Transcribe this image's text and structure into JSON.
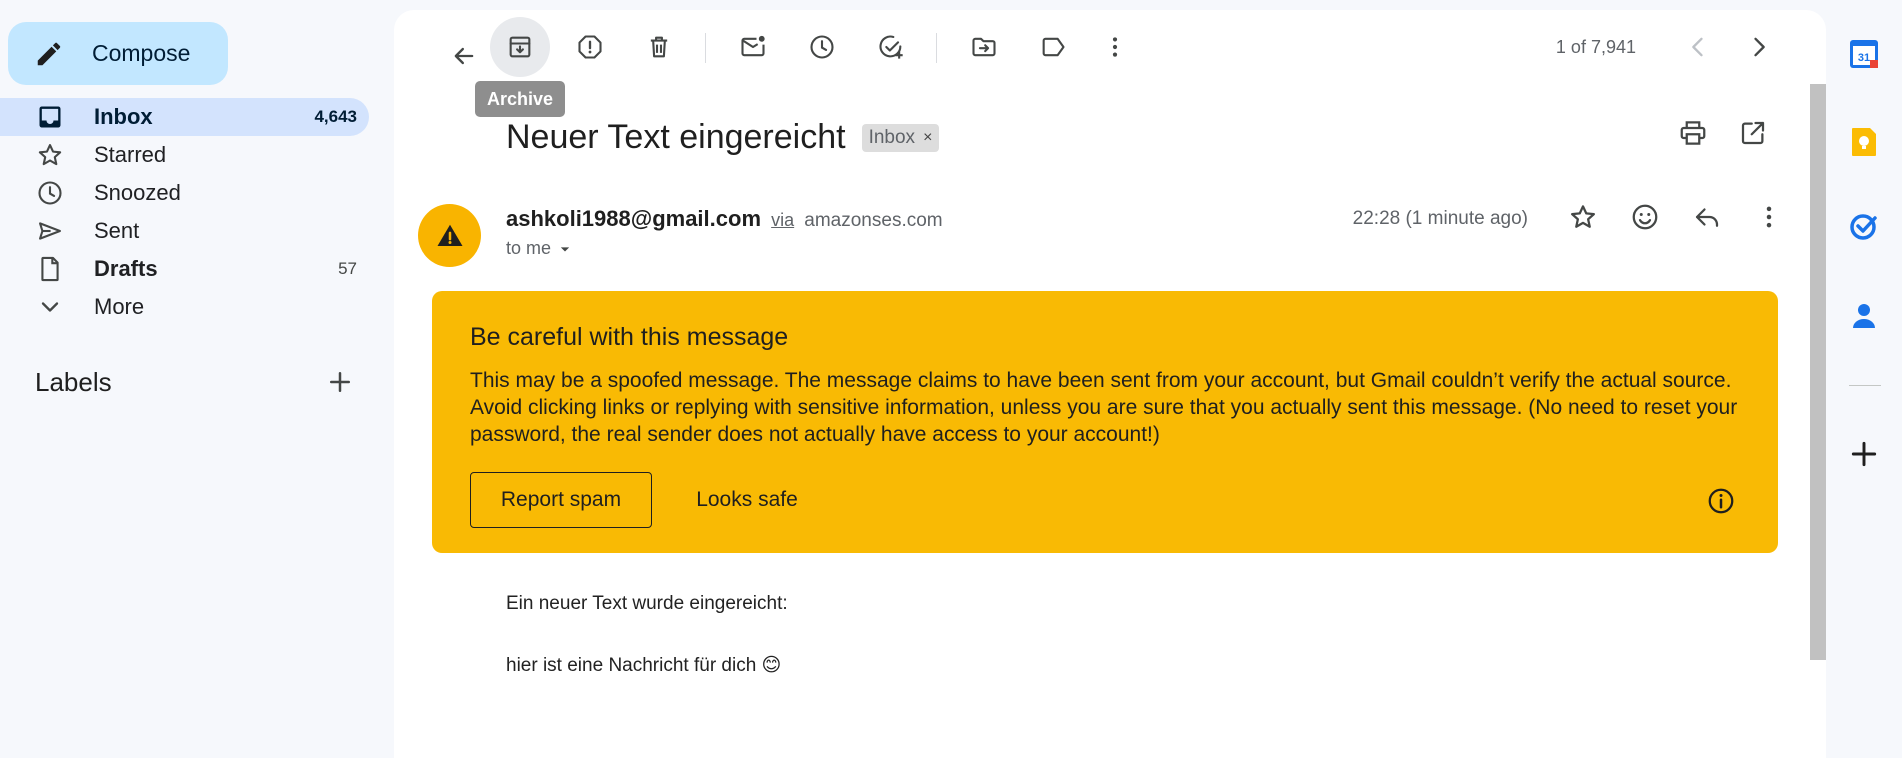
{
  "sidebar": {
    "compose_label": "Compose",
    "items": [
      {
        "icon": "inbox-icon",
        "label": "Inbox",
        "count": "4,643"
      },
      {
        "icon": "star-icon",
        "label": "Starred",
        "count": ""
      },
      {
        "icon": "clock-icon",
        "label": "Snoozed",
        "count": ""
      },
      {
        "icon": "send-icon",
        "label": "Sent",
        "count": ""
      },
      {
        "icon": "draft-icon",
        "label": "Drafts",
        "count": "57"
      },
      {
        "icon": "chevron-down-icon",
        "label": "More",
        "count": ""
      }
    ],
    "labels_title": "Labels"
  },
  "toolbar": {
    "tooltip": "Archive",
    "pager": "1 of 7,941"
  },
  "email": {
    "subject": "Neuer Text eingereicht",
    "badge": "Inbox",
    "badge_close": "×",
    "sender": "ashkoli1988@gmail.com",
    "via": "via",
    "via_domain": "amazonses.com",
    "to": "to me",
    "time": "22:28 (1 minute ago)",
    "warning": {
      "title": "Be careful with this message",
      "text": "This may be a spoofed message. The message claims to have been sent from your account, but Gmail couldn’t verify the actual source. Avoid clicking links or replying with sensitive information, unless you are sure that you actually sent this message. (No need to reset your password, the real sender does not actually have access to your account!)",
      "report_label": "Report spam",
      "safe_label": "Looks safe"
    },
    "body": [
      "Ein neuer Text wurde eingereicht:",
      "hier ist eine Nachricht für dich 😊"
    ]
  },
  "rail": {
    "calendar_day": "31"
  },
  "colors": {
    "accent": "#c2e7ff",
    "active_nav": "#d3e3fd",
    "warning": "#f9ba04",
    "background": "#f6f8fc"
  }
}
